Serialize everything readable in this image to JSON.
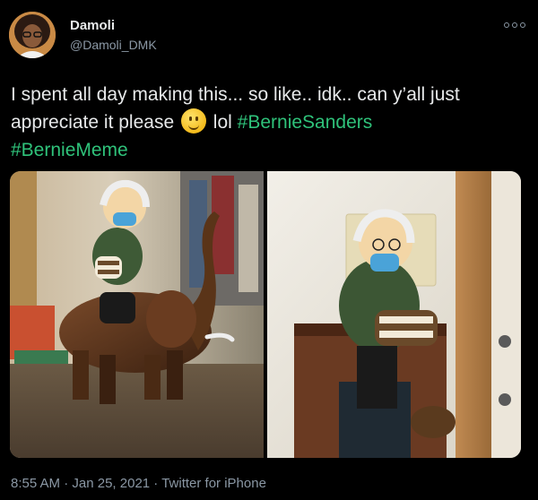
{
  "author": {
    "name": "Damoli",
    "handle": "@Damoli_DMK"
  },
  "tweet": {
    "text_part1": "I spent all day making this... so like.. idk.. can y’all just appreciate it please ",
    "text_part2": " lol ",
    "hashtag1": "#BernieSanders",
    "hashtag2": "#BernieMeme",
    "emoji": "slightly-smiling-face-emoji"
  },
  "footer": {
    "time": "8:55 AM",
    "sep1": " · ",
    "date": "Jan 25, 2021",
    "sep2": " · ",
    "source": "Twitter for iPhone"
  },
  "colors": {
    "background": "#000000",
    "text": "#e7e9ea",
    "muted": "#8b98a5",
    "hashtag": "#2fc27a"
  },
  "icons": [
    "more-options-icon"
  ]
}
